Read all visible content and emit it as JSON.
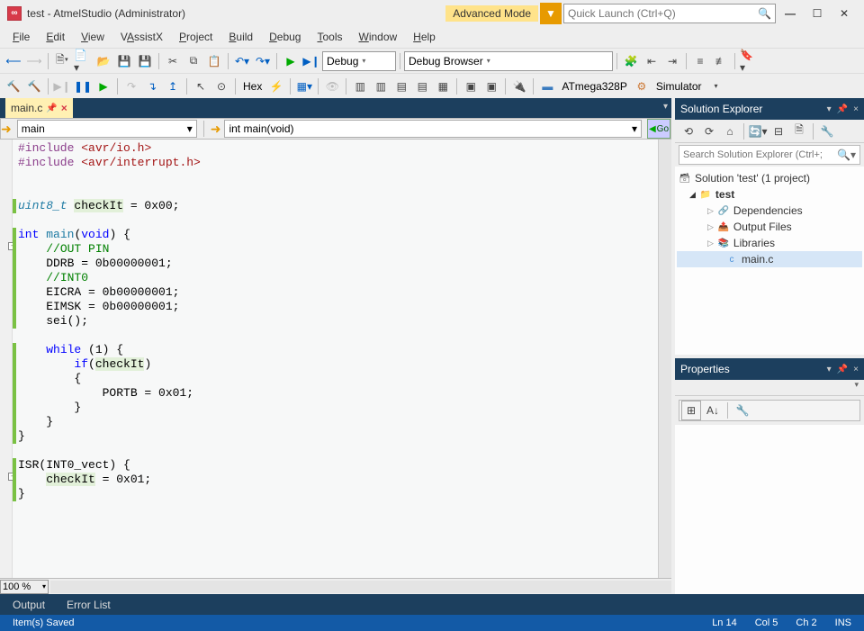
{
  "title": "test - AtmelStudio (Administrator)",
  "app_icon_glyph": "∞",
  "menu": {
    "file": "File",
    "edit": "Edit",
    "view": "View",
    "vassistx": "VAssistX",
    "project": "Project",
    "build": "Build",
    "debug": "Debug",
    "tools": "Tools",
    "window": "Window",
    "help": "Help"
  },
  "advanced_mode": "Advanced Mode",
  "quick_launch_placeholder": "Quick Launch (Ctrl+Q)",
  "toolbar": {
    "debug_config": "Debug",
    "debug_browser": "Debug Browser",
    "hex": "Hex",
    "device": "ATmega328P",
    "tool": "Simulator"
  },
  "doc_tab": {
    "name": "main.c"
  },
  "nav": {
    "scope": "main",
    "member": "int main(void)",
    "go": "Go"
  },
  "code_lines": [
    {
      "indent": "",
      "html": "<span class='tok-pre'>#include</span> <span class='tok-str'>&lt;avr/io.h&gt;</span>"
    },
    {
      "indent": "",
      "html": "<span class='tok-pre'>#include</span> <span class='tok-str'>&lt;avr/interrupt.h&gt;</span>"
    },
    {
      "indent": "",
      "html": ""
    },
    {
      "indent": "",
      "html": ""
    },
    {
      "indent": "",
      "html": "<span class='tok-type-u'>uint8_t</span> <span class='tok-hl'>checkIt</span> = 0x00;",
      "green": true
    },
    {
      "indent": "",
      "html": ""
    },
    {
      "indent": "",
      "html": "<span class='tok-kw'>int</span> <span class='tok-type'>main</span>(<span class='tok-kw'>void</span>) {",
      "fold": "-",
      "green": true
    },
    {
      "indent": "    ",
      "html": "<span class='tok-cmt'>//OUT PIN</span>",
      "green": true
    },
    {
      "indent": "    ",
      "html": "DDRB = 0b00000001;",
      "green": true
    },
    {
      "indent": "    ",
      "html": "<span class='tok-cmt'>//INT0</span>",
      "green": true
    },
    {
      "indent": "    ",
      "html": "EICRA = 0b00000001;",
      "green": true
    },
    {
      "indent": "    ",
      "html": "EIMSK = 0b00000001;",
      "green": true
    },
    {
      "indent": "    ",
      "html": "sei();",
      "green": true
    },
    {
      "indent": "    ",
      "html": ""
    },
    {
      "indent": "    ",
      "html": "<span class='tok-kw'>while</span> (1) {",
      "green": true
    },
    {
      "indent": "        ",
      "html": "<span class='tok-kw'>if</span>(<span class='tok-hl'>checkIt</span>)",
      "green": true
    },
    {
      "indent": "        ",
      "html": "{",
      "green": true
    },
    {
      "indent": "            ",
      "html": "PORTB = 0x01;",
      "green": true
    },
    {
      "indent": "        ",
      "html": "}",
      "green": true
    },
    {
      "indent": "    ",
      "html": "}",
      "green": true
    },
    {
      "indent": "",
      "html": "}",
      "green": true
    },
    {
      "indent": "",
      "html": ""
    },
    {
      "indent": "",
      "html": "ISR(INT0_vect) {",
      "fold": "-",
      "green": true
    },
    {
      "indent": "    ",
      "html": "<span class='tok-hl'>checkIt</span> = 0x01;",
      "green": true
    },
    {
      "indent": "",
      "html": "}",
      "green": true
    }
  ],
  "zoom": "100 %",
  "solution_explorer": {
    "title": "Solution Explorer",
    "search_placeholder": "Search Solution Explorer (Ctrl+;",
    "solution": "Solution 'test' (1 project)",
    "project": "test",
    "nodes": {
      "deps": "Dependencies",
      "output": "Output Files",
      "libs": "Libraries",
      "mainc": "main.c"
    }
  },
  "properties": {
    "title": "Properties"
  },
  "bottom_tabs": {
    "output": "Output",
    "error_list": "Error List"
  },
  "status": {
    "msg": "Item(s) Saved",
    "ln": "Ln 14",
    "col": "Col 5",
    "ch": "Ch 2",
    "ins": "INS"
  }
}
